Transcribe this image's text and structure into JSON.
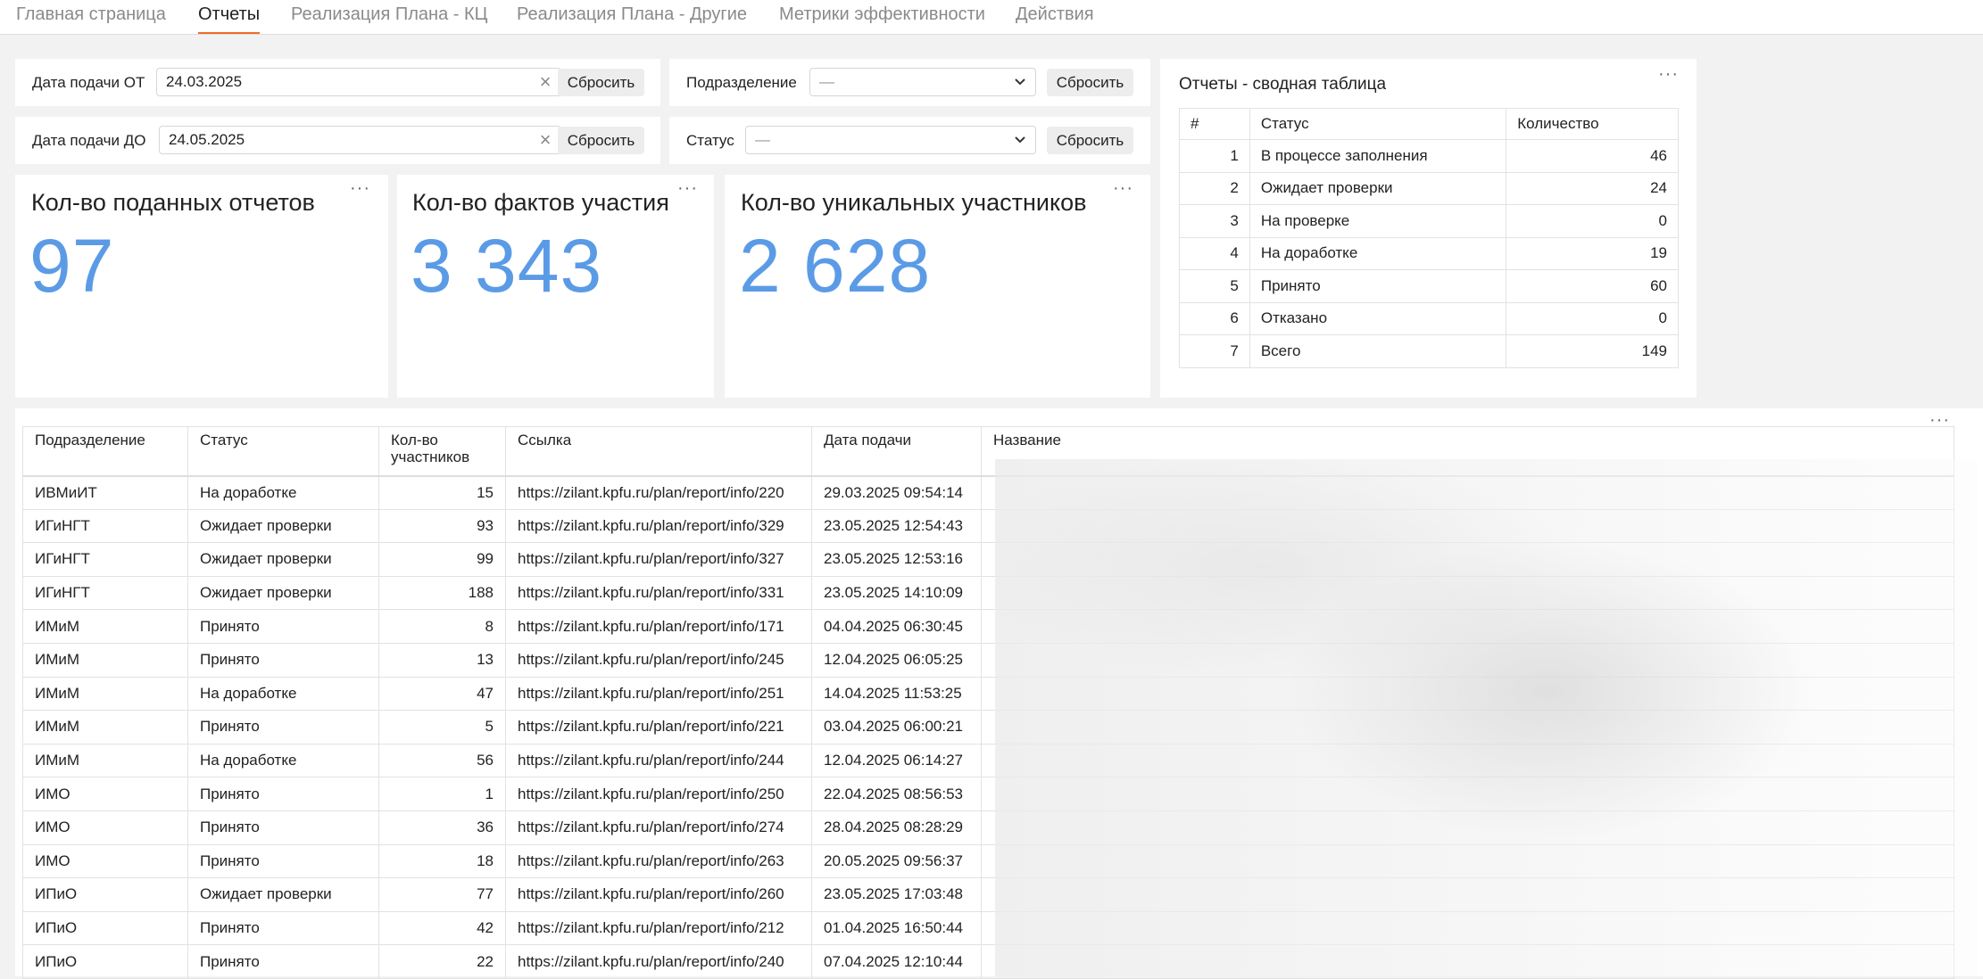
{
  "tabs": [
    {
      "label": "Главная страница"
    },
    {
      "label": "Отчеты"
    },
    {
      "label": "Реализация Плана - КЦ"
    },
    {
      "label": "Реализация Плана - Другие"
    },
    {
      "label": "Метрики эффективности"
    },
    {
      "label": "Действия"
    }
  ],
  "active_tab": "Отчеты",
  "filters": {
    "date_from": {
      "label": "Дата подачи ОТ",
      "value": "24.03.2025",
      "reset": "Сбросить"
    },
    "date_to": {
      "label": "Дата подачи ДО",
      "value": "24.05.2025",
      "reset": "Сбросить"
    },
    "division": {
      "label": "Подразделение",
      "value": "—",
      "reset": "Сбросить"
    },
    "status": {
      "label": "Статус",
      "value": "—",
      "reset": "Сбросить"
    }
  },
  "kpis": [
    {
      "title": "Кол-во поданных отчетов",
      "value": "97"
    },
    {
      "title": "Кол-во фактов участия",
      "value": "3 343"
    },
    {
      "title": "Кол-во уникальных участников",
      "value": "2 628"
    }
  ],
  "menu_dots": "···",
  "kpi_color": "#5b9be6",
  "accent_color": "#f26b2b",
  "summary": {
    "title": "Отчеты - сводная таблица",
    "headers": [
      "#",
      "Статус",
      "Количество"
    ],
    "rows": [
      [
        "1",
        "В процессе заполнения",
        "46"
      ],
      [
        "2",
        "Ожидает проверки",
        "24"
      ],
      [
        "3",
        "На проверке",
        "0"
      ],
      [
        "4",
        "На доработке",
        "19"
      ],
      [
        "5",
        "Принято",
        "60"
      ],
      [
        "6",
        "Отказано",
        "0"
      ],
      [
        "7",
        "Всего",
        "149"
      ]
    ]
  },
  "reports": {
    "headers": [
      "Подразделение",
      "Статус",
      "Кол-во участников",
      "Ссылка",
      "Дата подачи",
      "Название"
    ],
    "rows": [
      [
        "ИВМиИТ",
        "На доработке",
        "15",
        "https://zilant.kpfu.ru/plan/report/info/220",
        "29.03.2025 09:54:14"
      ],
      [
        "ИГиНГТ",
        "Ожидает проверки",
        "93",
        "https://zilant.kpfu.ru/plan/report/info/329",
        "23.05.2025 12:54:43"
      ],
      [
        "ИГиНГТ",
        "Ожидает проверки",
        "99",
        "https://zilant.kpfu.ru/plan/report/info/327",
        "23.05.2025 12:53:16"
      ],
      [
        "ИГиНГТ",
        "Ожидает проверки",
        "188",
        "https://zilant.kpfu.ru/plan/report/info/331",
        "23.05.2025 14:10:09"
      ],
      [
        "ИМиМ",
        "Принято",
        "8",
        "https://zilant.kpfu.ru/plan/report/info/171",
        "04.04.2025 06:30:45"
      ],
      [
        "ИМиМ",
        "Принято",
        "13",
        "https://zilant.kpfu.ru/plan/report/info/245",
        "12.04.2025 06:05:25"
      ],
      [
        "ИМиМ",
        "На доработке",
        "47",
        "https://zilant.kpfu.ru/plan/report/info/251",
        "14.04.2025 11:53:25"
      ],
      [
        "ИМиМ",
        "Принято",
        "5",
        "https://zilant.kpfu.ru/plan/report/info/221",
        "03.04.2025 06:00:21"
      ],
      [
        "ИМиМ",
        "На доработке",
        "56",
        "https://zilant.kpfu.ru/plan/report/info/244",
        "12.04.2025 06:14:27"
      ],
      [
        "ИМО",
        "Принято",
        "1",
        "https://zilant.kpfu.ru/plan/report/info/250",
        "22.04.2025 08:56:53"
      ],
      [
        "ИМО",
        "Принято",
        "36",
        "https://zilant.kpfu.ru/plan/report/info/274",
        "28.04.2025 08:28:29"
      ],
      [
        "ИМО",
        "Принято",
        "18",
        "https://zilant.kpfu.ru/plan/report/info/263",
        "20.05.2025 09:56:37"
      ],
      [
        "ИПиО",
        "Ожидает проверки",
        "77",
        "https://zilant.kpfu.ru/plan/report/info/260",
        "23.05.2025 17:03:48"
      ],
      [
        "ИПиО",
        "Принято",
        "42",
        "https://zilant.kpfu.ru/plan/report/info/212",
        "01.04.2025 16:50:44"
      ],
      [
        "ИПиО",
        "Принято",
        "22",
        "https://zilant.kpfu.ru/plan/report/info/240",
        "07.04.2025 12:10:44"
      ]
    ]
  }
}
